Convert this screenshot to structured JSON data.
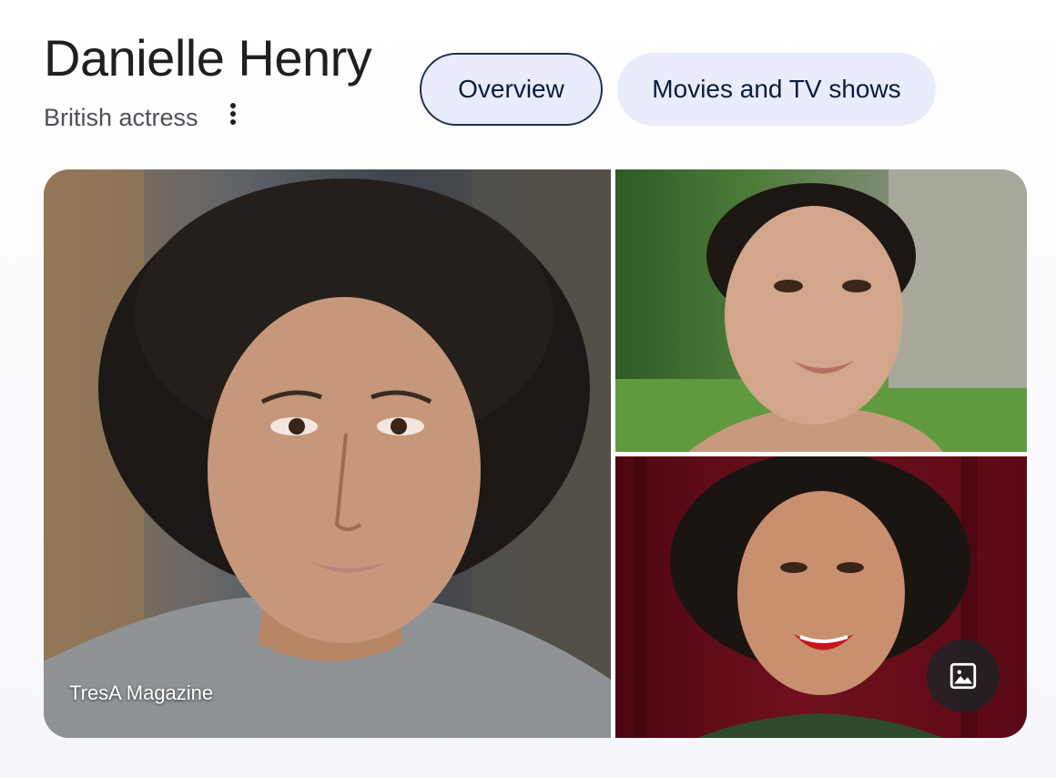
{
  "entity": {
    "name": "Danielle Henry",
    "description": "British actress"
  },
  "more_icon": "more-vertical-icon",
  "tabs": [
    {
      "label": "Overview",
      "active": true
    },
    {
      "label": "Movies and TV shows",
      "active": false
    }
  ],
  "gallery": {
    "main_image_source": "TresA Magazine",
    "images_button_icon": "image-icon"
  },
  "colors": {
    "title": "#1f1f1f",
    "subtitle": "#4d5156",
    "tab_background": "#e9ecfa",
    "tab_text": "#0b1c3d",
    "tab_active_border": "#1c2e50"
  }
}
